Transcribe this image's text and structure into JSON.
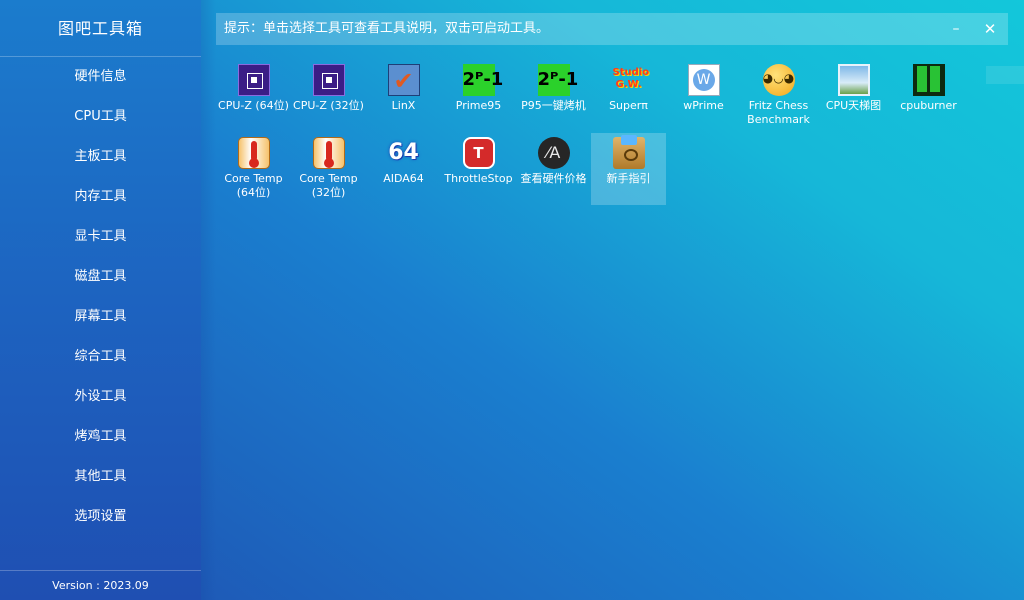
{
  "app": {
    "title": "图吧工具箱",
    "version": "Version : 2023.09"
  },
  "sidebar": {
    "items": [
      {
        "label": "硬件信息"
      },
      {
        "label": "CPU工具"
      },
      {
        "label": "主板工具"
      },
      {
        "label": "内存工具"
      },
      {
        "label": "显卡工具"
      },
      {
        "label": "磁盘工具"
      },
      {
        "label": "屏幕工具"
      },
      {
        "label": "综合工具"
      },
      {
        "label": "外设工具"
      },
      {
        "label": "烤鸡工具"
      },
      {
        "label": "其他工具"
      },
      {
        "label": "选项设置"
      }
    ]
  },
  "header": {
    "tip": "提示：单击选择工具可查看工具说明，双击可启动工具。",
    "minimize_glyph": "–",
    "close_glyph": "✕"
  },
  "tools": [
    {
      "label": "CPU-Z (64位)",
      "icon": "cpuz-icon",
      "glyph": ""
    },
    {
      "label": "CPU-Z (32位)",
      "icon": "cpuz-icon",
      "glyph": ""
    },
    {
      "label": "LinX",
      "icon": "linx-icon",
      "glyph": "✔"
    },
    {
      "label": "Prime95",
      "icon": "prime95-icon",
      "glyph": "2ᴾ-1"
    },
    {
      "label": "P95一键烤机",
      "icon": "prime95-icon",
      "glyph": "2ᴾ-1"
    },
    {
      "label": "Superπ",
      "icon": "superpi-icon",
      "glyph": "Studio\nG.W."
    },
    {
      "label": "wPrime",
      "icon": "wprime-icon",
      "glyph": "W"
    },
    {
      "label": "Fritz Chess\nBenchmark",
      "icon": "fritz-icon",
      "glyph": "◕◡◕"
    },
    {
      "label": "CPU天梯图",
      "icon": "cpu-ladder-icon",
      "glyph": ""
    },
    {
      "label": "cpuburner",
      "icon": "cpuburner-icon",
      "glyph": ""
    },
    {
      "label": "Core Temp\n(64位)",
      "icon": "coretemp-icon",
      "glyph": ""
    },
    {
      "label": "Core Temp\n(32位)",
      "icon": "coretemp-icon",
      "glyph": ""
    },
    {
      "label": "AIDA64",
      "icon": "aida64-icon",
      "glyph": "64"
    },
    {
      "label": "ThrottleStop",
      "icon": "throttlestop-icon",
      "glyph": "T"
    },
    {
      "label": "查看硬件价格",
      "icon": "hardware-price-icon",
      "glyph": "⁄A"
    },
    {
      "label": "新手指引",
      "icon": "guide-icon",
      "glyph": "",
      "selected": true
    }
  ]
}
